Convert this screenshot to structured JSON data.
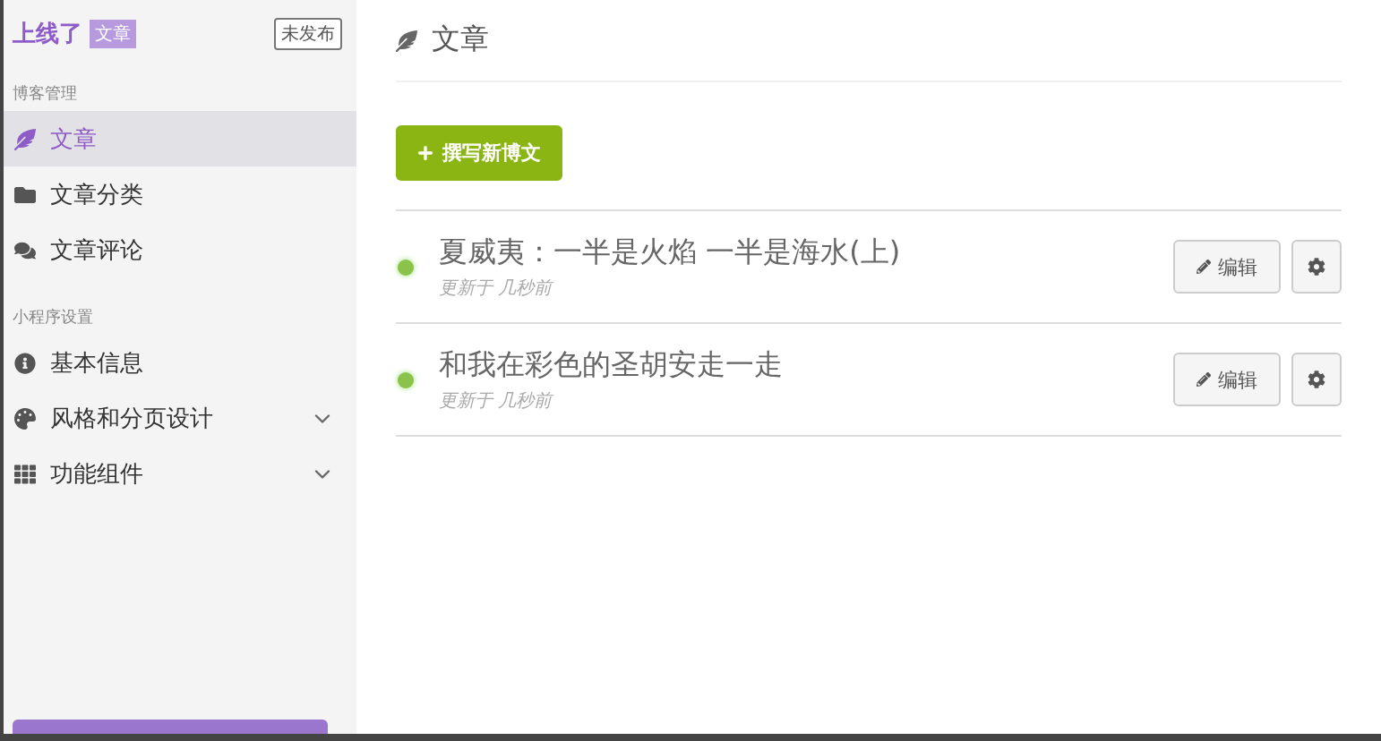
{
  "brand": {
    "logo": "上线了",
    "tag": "文章",
    "status": "未发布"
  },
  "sidebar": {
    "sections": [
      {
        "title": "博客管理",
        "items": [
          {
            "label": "文章",
            "selected": true
          },
          {
            "label": "文章分类",
            "selected": false
          },
          {
            "label": "文章评论",
            "selected": false
          }
        ]
      },
      {
        "title": "小程序设置",
        "items": [
          {
            "label": "基本信息",
            "selected": false
          },
          {
            "label": "风格和分页设计",
            "selected": false,
            "expanded": false
          },
          {
            "label": "功能组件",
            "selected": false,
            "expanded": false
          }
        ]
      }
    ]
  },
  "page": {
    "title": "文章",
    "new_button": "撰写新博文",
    "posts": [
      {
        "title": "夏威夷：一半是火焰 一半是海水(上)",
        "updated": "更新于 几秒前",
        "edit": "编辑"
      },
      {
        "title": "和我在彩色的圣胡安走一走",
        "updated": "更新于 几秒前",
        "edit": "编辑"
      }
    ]
  }
}
